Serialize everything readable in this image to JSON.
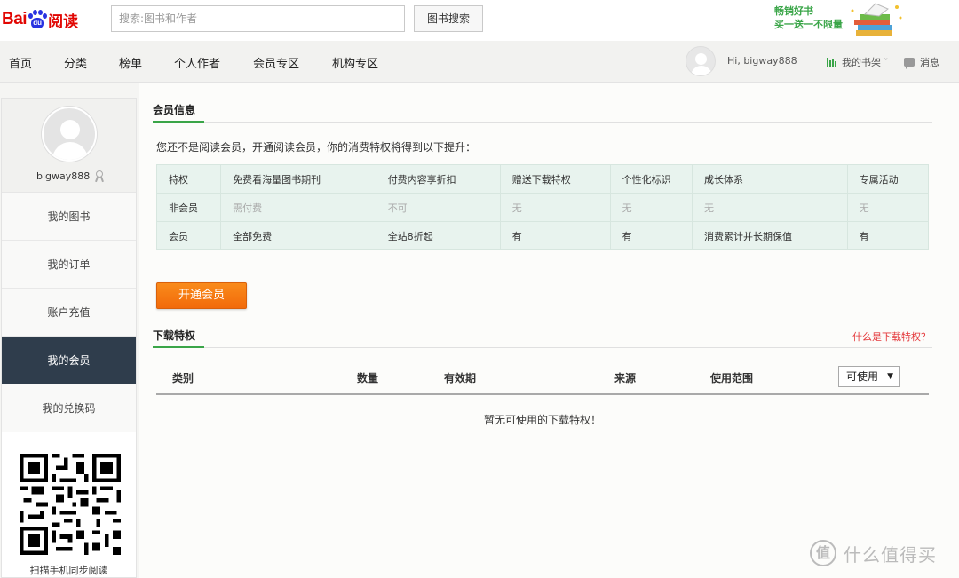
{
  "header": {
    "logo_text_left": "Bai",
    "logo_text_paw": "du",
    "logo_text_right": "阅读",
    "search_placeholder": "搜索:图书和作者",
    "search_button": "图书搜索",
    "promo_line1": "畅销好书",
    "promo_line2": "买一送一不限量"
  },
  "nav": {
    "items": [
      "首页",
      "分类",
      "榜单",
      "个人作者",
      "会员专区",
      "机构专区"
    ],
    "greeting": "Hi, bigway888",
    "bookshelf": "我的书架",
    "bookshelf_caret": "ˇ",
    "messages": "消息"
  },
  "sidebar": {
    "username": "bigway888",
    "items": [
      "我的图书",
      "我的订单",
      "账户充值",
      "我的会员",
      "我的兑换码"
    ],
    "active_index": 3,
    "qr_caption": "扫描手机同步阅读"
  },
  "member": {
    "section_title": "会员信息",
    "intro": "您还不是阅读会员，开通阅读会员，你的消费特权将得到以下提升：",
    "table": {
      "header": [
        "特权",
        "免费看海量图书期刊",
        "付费内容享折扣",
        "赠送下载特权",
        "个性化标识",
        "成长体系",
        "专属活动"
      ],
      "non_member": [
        "非会员",
        "需付费",
        "不可",
        "无",
        "无",
        "无",
        "无"
      ],
      "member": [
        "会员",
        "全部免费",
        "全站8折起",
        "有",
        "有",
        "消费累计并长期保值",
        "有"
      ]
    },
    "open_button": "开通会员"
  },
  "download": {
    "section_title": "下载特权",
    "help_link": "什么是下载特权？",
    "columns": [
      "类别",
      "数量",
      "有效期",
      "来源",
      "使用范围"
    ],
    "filter_value": "可使用",
    "filter_arrow": "▼",
    "empty_text": "暂无可使用的下载特权！"
  },
  "watermark": {
    "symbol": "值",
    "text": "什么值得买"
  },
  "colors": {
    "brand_red": "#e10602",
    "brand_blue": "#2932e1",
    "accent_green": "#3aa548",
    "sidebar_active": "#2f3d4c",
    "cta_orange": "#f26a0a",
    "link_red": "#e4393c"
  }
}
